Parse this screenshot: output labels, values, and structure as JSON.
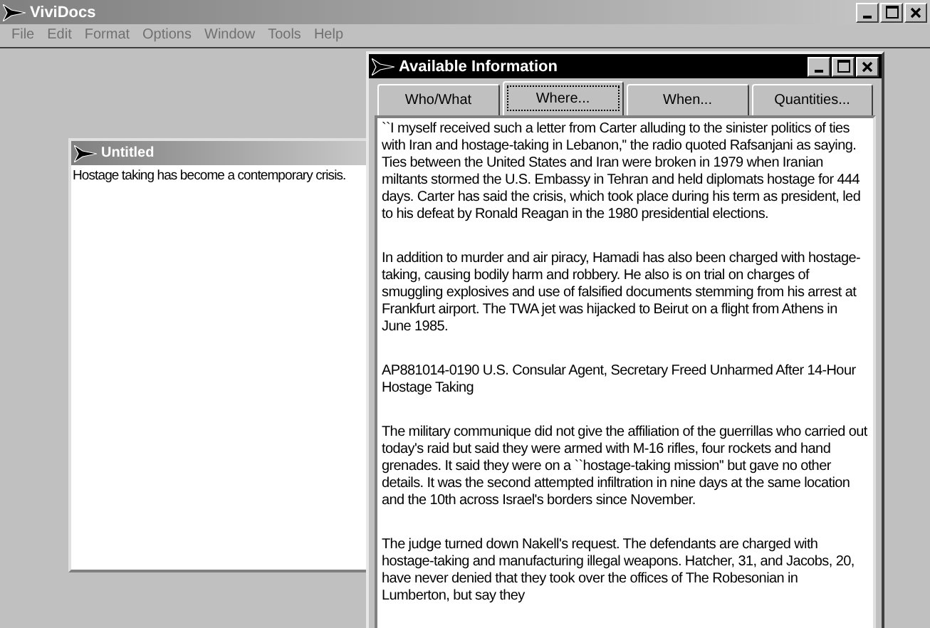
{
  "app": {
    "title": "ViviDocs",
    "menu": [
      "File",
      "Edit",
      "Format",
      "Options",
      "Window",
      "Tools",
      "Help"
    ]
  },
  "document": {
    "title": "Untitled",
    "text": "Hostage taking has become a contemporary crisis."
  },
  "dialog": {
    "title": "Available Information",
    "tabs": [
      {
        "label": "Who/What",
        "selected": false
      },
      {
        "label": "Where...",
        "selected": true
      },
      {
        "label": "When...",
        "selected": false
      },
      {
        "label": "Quantities...",
        "selected": false
      }
    ],
    "paragraphs": [
      "``I myself received such a letter from Carter alluding to the sinister politics of ties with Iran and hostage-taking in Lebanon,'' the radio quoted Rafsanjani as saying. Ties between the United States and Iran were broken in 1979 when Iranian miltants stormed the U.S. Embassy in Tehran and held diplomats hostage for 444 days. Carter has said the crisis, which took place during his term as president, led to his defeat by Ronald Reagan in the 1980 presidential elections.",
      "In addition to murder and air piracy, Hamadi has also been charged with hostage-taking, causing bodily harm and robbery. He also is on trial on charges of smuggling explosives and use of falsified documents stemming from his arrest at Frankfurt airport. The TWA jet was hijacked to Beirut on a flight from Athens in June 1985.",
      "AP881014-0190 U.S. Consular Agent, Secretary Freed Unharmed After 14-Hour Hostage Taking",
      "The military communique did not give the affiliation of the guerrillas who carried out today's raid but said they were armed with M-16 rifles, four rockets and hand grenades. It said they were on a ``hostage-taking mission'' but gave no other details. It was the second attempted infiltration in nine days at the same location and the 10th across Israel's borders since November.",
      "The judge turned down Nakell's request. The defendants are charged with hostage-taking and manufacturing illegal weapons. Hatcher, 31, and Jacobs, 20, have never denied that they took over the offices of The Robesonian in Lumberton, but say they"
    ]
  }
}
